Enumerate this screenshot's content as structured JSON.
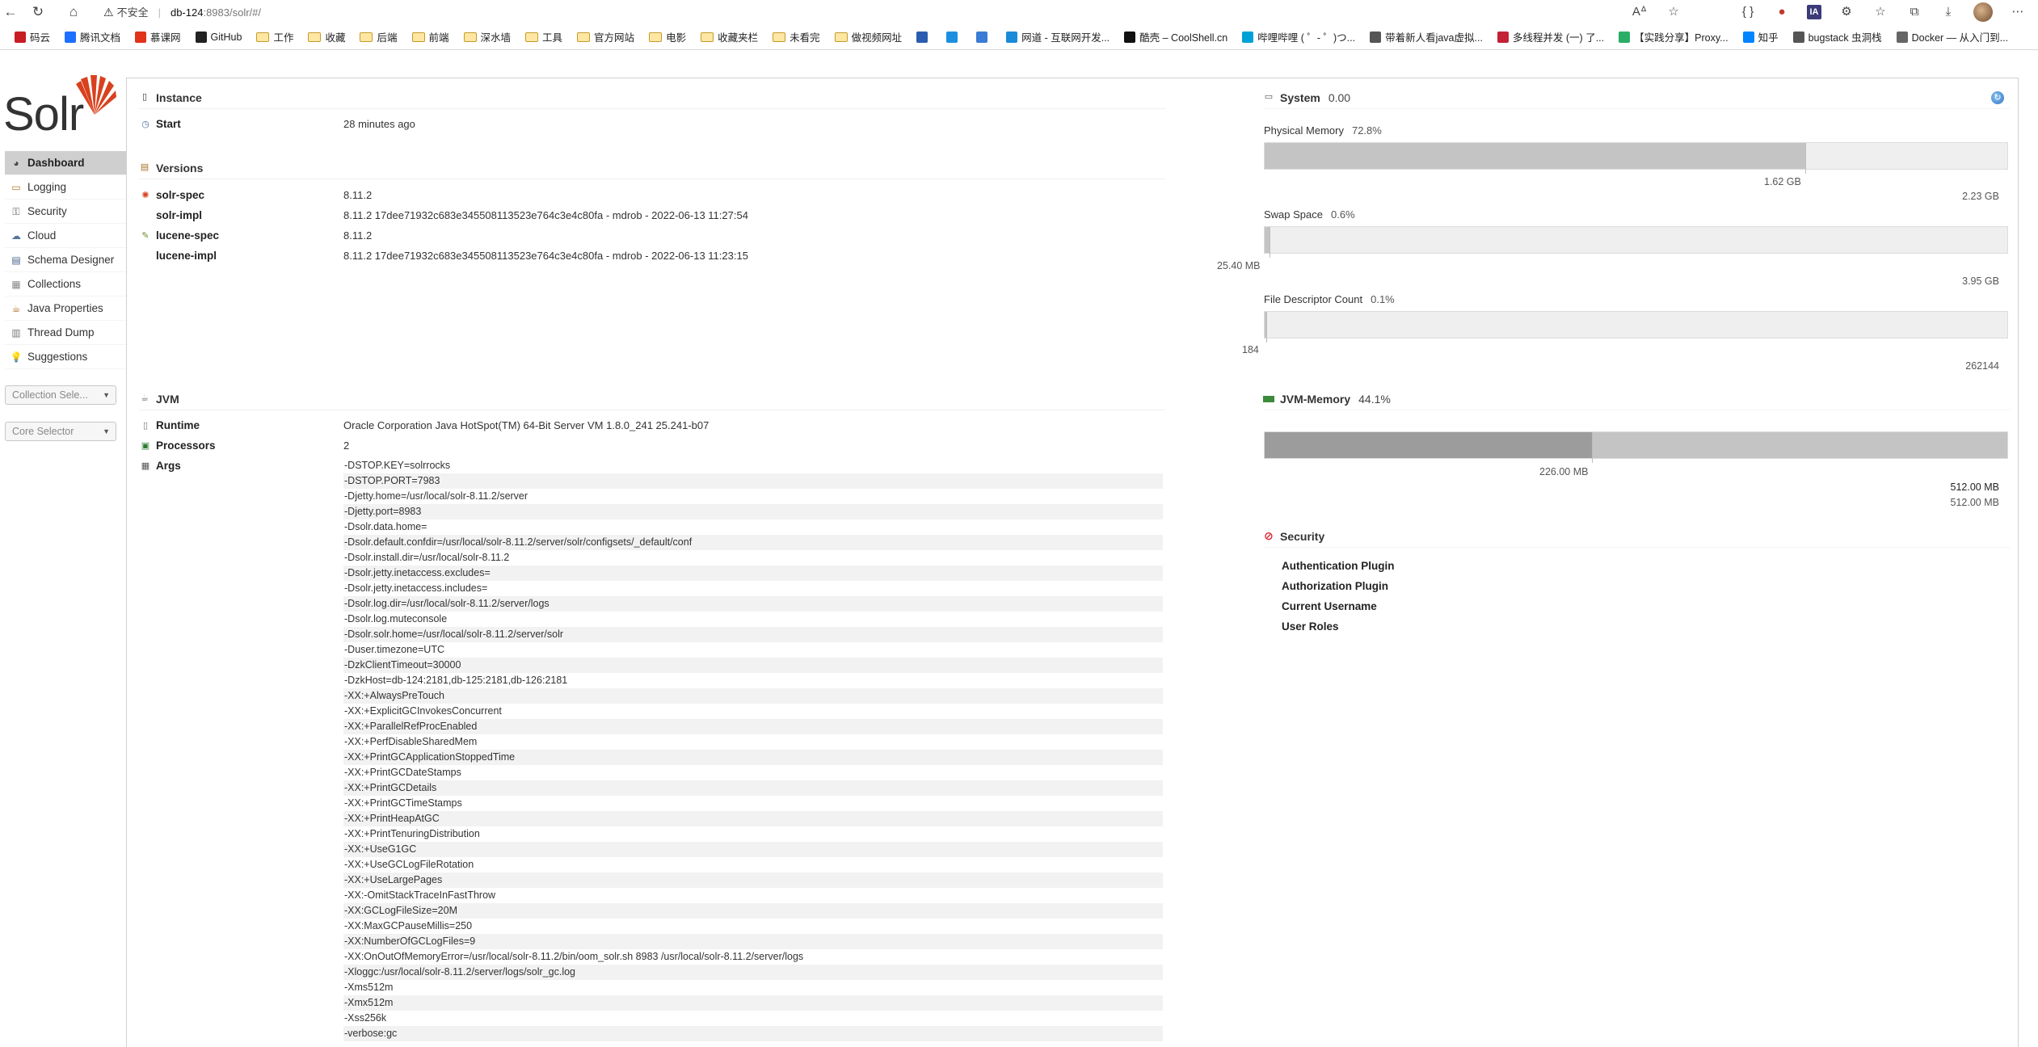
{
  "browser": {
    "insecure_label": "不安全",
    "url_host": "db-124",
    "url_path": ":8983/solr/#/",
    "bookmarks": [
      {
        "label": "码云",
        "icon": "gitee-icon",
        "color": "#c71d23"
      },
      {
        "label": "腾讯文档",
        "icon": "tencent-docs-icon",
        "color": "#1e6fff"
      },
      {
        "label": "慕课网",
        "icon": "imooc-icon",
        "color": "#e0331a"
      },
      {
        "label": "GitHub",
        "icon": "github-icon",
        "color": "#222222"
      },
      {
        "label": "工作",
        "icon": "folder-icon",
        "color": ""
      },
      {
        "label": "收藏",
        "icon": "folder-icon",
        "color": ""
      },
      {
        "label": "后端",
        "icon": "folder-icon",
        "color": ""
      },
      {
        "label": "前端",
        "icon": "folder-icon",
        "color": ""
      },
      {
        "label": "深水墙",
        "icon": "folder-icon",
        "color": ""
      },
      {
        "label": "工具",
        "icon": "folder-icon",
        "color": ""
      },
      {
        "label": "官方网站",
        "icon": "folder-icon",
        "color": ""
      },
      {
        "label": "电影",
        "icon": "folder-icon",
        "color": ""
      },
      {
        "label": "收藏夹栏",
        "icon": "folder-icon",
        "color": ""
      },
      {
        "label": "未看完",
        "icon": "folder-icon",
        "color": ""
      },
      {
        "label": "做视频网址",
        "icon": "folder-icon",
        "color": ""
      },
      {
        "label": "",
        "icon": "msdn-icon",
        "color": "#2a5db0"
      },
      {
        "label": "",
        "icon": "tiaoshi-icon",
        "color": "#1d8fe1"
      },
      {
        "label": "",
        "icon": "translate-icon",
        "color": "#3a7bd5"
      },
      {
        "label": "网道 - 互联网开发...",
        "icon": "wangdao-icon",
        "color": "#1a8bd8"
      },
      {
        "label": "酷壳 – CoolShell.cn",
        "icon": "coolshell-icon",
        "color": "#111111"
      },
      {
        "label": "哔哩哔哩 ( ゜- ゜)つ...",
        "icon": "bilibili-icon",
        "color": "#00a1d6"
      },
      {
        "label": "带着新人看java虚拟...",
        "icon": "cat-icon",
        "color": "#555555"
      },
      {
        "label": "多线程并发 (一) 了...",
        "icon": "csdn-icon",
        "color": "#c32136"
      },
      {
        "label": "【实践分享】Proxy...",
        "icon": "wechat-icon",
        "color": "#2aae67"
      },
      {
        "label": "知乎",
        "icon": "zhihu-icon",
        "color": "#0084ff"
      },
      {
        "label": "bugstack 虫洞栈",
        "icon": "bugstack-icon",
        "color": "#555555"
      },
      {
        "label": "Docker — 从入门到...",
        "icon": "page-icon",
        "color": "#666666"
      }
    ]
  },
  "logo": {
    "text": "Solr"
  },
  "menu": [
    {
      "label": "Dashboard",
      "icon": "dashboard-icon",
      "active": true
    },
    {
      "label": "Logging",
      "icon": "logging-icon",
      "active": false
    },
    {
      "label": "Security",
      "icon": "security-key-icon",
      "active": false
    },
    {
      "label": "Cloud",
      "icon": "cloud-icon",
      "active": false
    },
    {
      "label": "Schema Designer",
      "icon": "schema-icon",
      "active": false
    },
    {
      "label": "Collections",
      "icon": "collections-icon",
      "active": false
    },
    {
      "label": "Java Properties",
      "icon": "java-icon",
      "active": false
    },
    {
      "label": "Thread Dump",
      "icon": "thread-icon",
      "active": false
    },
    {
      "label": "Suggestions",
      "icon": "bulb-icon",
      "active": false
    }
  ],
  "selectors": {
    "collection": "Collection Sele...",
    "core": "Core Selector"
  },
  "instance": {
    "title": "Instance",
    "start_label": "Start",
    "start_value": "28 minutes ago"
  },
  "versions": {
    "title": "Versions",
    "rows": [
      {
        "key": "solr-spec",
        "value": "8.11.2"
      },
      {
        "key": "solr-impl",
        "value": "8.11.2 17dee71932c683e345508113523e764c3e4c80fa - mdrob - 2022-06-13 11:27:54"
      },
      {
        "key": "lucene-spec",
        "value": "8.11.2"
      },
      {
        "key": "lucene-impl",
        "value": "8.11.2 17dee71932c683e345508113523e764c3e4c80fa - mdrob - 2022-06-13 11:23:15"
      }
    ]
  },
  "jvm": {
    "title": "JVM",
    "runtime_label": "Runtime",
    "runtime_value": "Oracle Corporation Java HotSpot(TM) 64-Bit Server VM 1.8.0_241 25.241-b07",
    "processors_label": "Processors",
    "processors_value": "2",
    "args_label": "Args",
    "args": [
      "-DSTOP.KEY=solrrocks",
      "-DSTOP.PORT=7983",
      "-Djetty.home=/usr/local/solr-8.11.2/server",
      "-Djetty.port=8983",
      "-Dsolr.data.home=",
      "-Dsolr.default.confdir=/usr/local/solr-8.11.2/server/solr/configsets/_default/conf",
      "-Dsolr.install.dir=/usr/local/solr-8.11.2",
      "-Dsolr.jetty.inetaccess.excludes=",
      "-Dsolr.jetty.inetaccess.includes=",
      "-Dsolr.log.dir=/usr/local/solr-8.11.2/server/logs",
      "-Dsolr.log.muteconsole",
      "-Dsolr.solr.home=/usr/local/solr-8.11.2/server/solr",
      "-Duser.timezone=UTC",
      "-DzkClientTimeout=30000",
      "-DzkHost=db-124:2181,db-125:2181,db-126:2181",
      "-XX:+AlwaysPreTouch",
      "-XX:+ExplicitGCInvokesConcurrent",
      "-XX:+ParallelRefProcEnabled",
      "-XX:+PerfDisableSharedMem",
      "-XX:+PrintGCApplicationStoppedTime",
      "-XX:+PrintGCDateStamps",
      "-XX:+PrintGCDetails",
      "-XX:+PrintGCTimeStamps",
      "-XX:+PrintHeapAtGC",
      "-XX:+PrintTenuringDistribution",
      "-XX:+UseG1GC",
      "-XX:+UseGCLogFileRotation",
      "-XX:+UseLargePages",
      "-XX:-OmitStackTraceInFastThrow",
      "-XX:GCLogFileSize=20M",
      "-XX:MaxGCPauseMillis=250",
      "-XX:NumberOfGCLogFiles=9",
      "-XX:OnOutOfMemoryError=/usr/local/solr-8.11.2/bin/oom_solr.sh 8983 /usr/local/solr-8.11.2/server/logs",
      "-Xloggc:/usr/local/solr-8.11.2/server/logs/solr_gc.log",
      "-Xms512m",
      "-Xmx512m",
      "-Xss256k",
      "-verbose:gc"
    ]
  },
  "system": {
    "title": "System",
    "load": "0.00",
    "physical_memory": {
      "label": "Physical Memory",
      "pct_text": "72.8%",
      "fraction": 0.728,
      "used": "1.62 GB",
      "total": "2.23 GB"
    },
    "swap_space": {
      "label": "Swap Space",
      "pct_text": "0.6%",
      "fraction": 0.006,
      "used": "25.40 MB",
      "total": "3.95 GB"
    },
    "file_descriptor": {
      "label": "File Descriptor Count",
      "pct_text": "0.1%",
      "fraction": 0.001,
      "used": "184",
      "total": "262144"
    }
  },
  "jvm_memory": {
    "title": "JVM-Memory",
    "pct_text": "44.1%",
    "used_fraction": 0.441,
    "used": "226.00 MB",
    "committed": "512.00 MB",
    "max": "512.00 MB"
  },
  "security": {
    "title": "Security",
    "items": [
      "Authentication Plugin",
      "Authorization Plugin",
      "Current Username",
      "User Roles"
    ]
  },
  "colors": {
    "bar_fill": "#c4c4c4",
    "jvm_used_fill": "#9c9c9c",
    "jvm_committed_fill": "#c4c4c4",
    "bar_bg": "#efefef",
    "menu_active": "#cfcfcf",
    "solr_red": "#d9411e"
  }
}
